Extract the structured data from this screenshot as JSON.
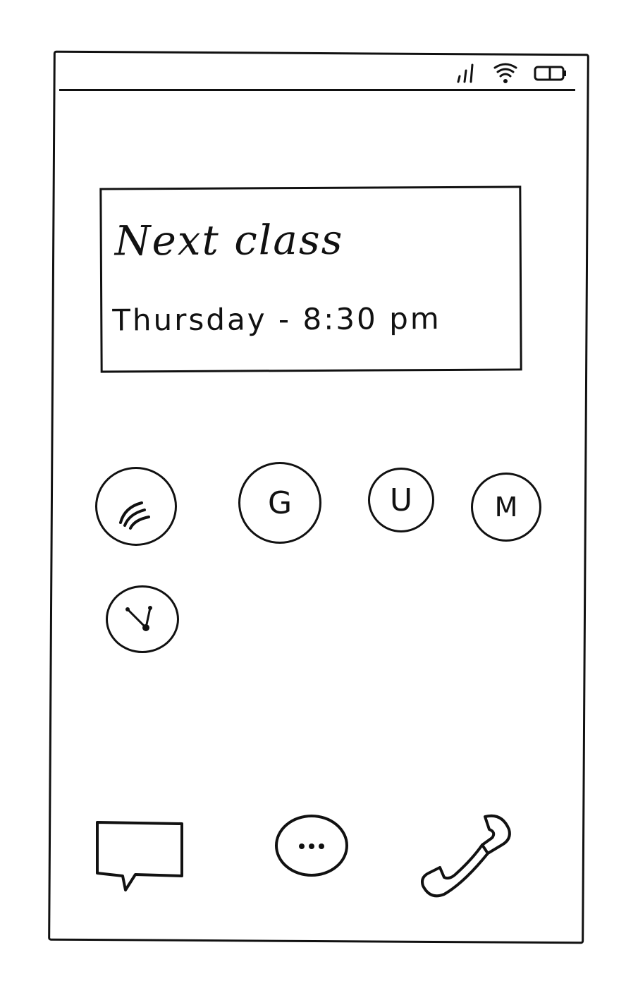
{
  "status_bar": {
    "icons": [
      "signal-icon",
      "wifi-icon",
      "battery-icon"
    ]
  },
  "next_class_card": {
    "title": "Next class",
    "subtitle": "Thursday - 8:30 pm"
  },
  "app_grid": {
    "apps": [
      {
        "name": "feed-app-icon",
        "letter": ""
      },
      {
        "name": "g-app-icon",
        "letter": "G"
      },
      {
        "name": "u-app-icon",
        "letter": "U"
      },
      {
        "name": "m-app-icon",
        "letter": "M"
      },
      {
        "name": "clock-app-icon",
        "letter": ""
      }
    ]
  },
  "dock": {
    "items": [
      "messages-icon",
      "app-drawer-icon",
      "phone-icon"
    ]
  }
}
